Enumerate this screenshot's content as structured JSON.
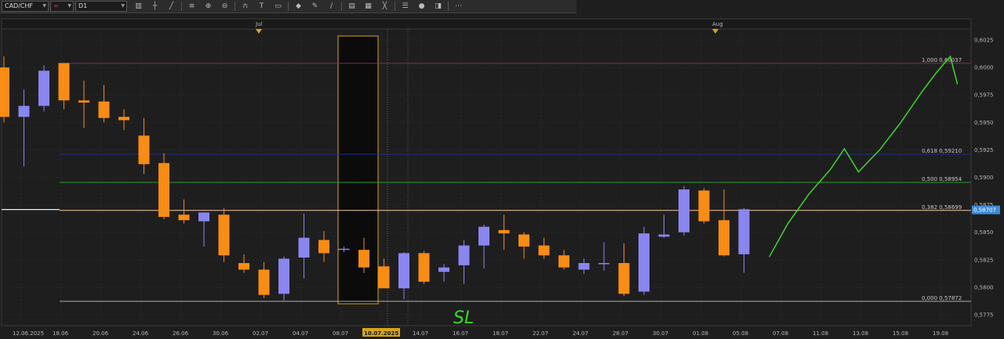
{
  "toolbar": {
    "symbol": "CAD/CHF",
    "timeframe": "D1",
    "icons": [
      "chart-type-icon",
      "crosshair-icon",
      "line-icon",
      "fib-icon",
      "zoom-in-icon",
      "zoom-out-icon",
      "magnet-icon",
      "text-icon",
      "note-icon",
      "shapes-icon",
      "brush-icon",
      "pen-icon",
      "objects-icon",
      "template-icon",
      "hide-icon",
      "layers-icon",
      "circle-icon",
      "eraser-icon",
      "more-icon"
    ]
  },
  "colors": {
    "background": "#1e1e1e",
    "grid": "#2a2a2a",
    "bull": "#8a86f0",
    "bear": "#f98c14",
    "fib_100": "#7a2e62",
    "fib_618": "#1c2e8a",
    "fib_500": "#2e9b2e",
    "fib_382": "#f7c79b",
    "fib_0": "#b0b0b0",
    "annotation": "#3fd62c",
    "price_tag": "#3c8cd8",
    "marker": "#d7a51a"
  },
  "chart_data": {
    "type": "candlestick",
    "symbol": "CAD/CHF",
    "timeframe": "D1",
    "ylim": [
      0.5765,
      0.6035
    ],
    "y_ticks": [
      "0,5775",
      "0,5800",
      "0,5825",
      "0,5850",
      "0,5875",
      "0,5900",
      "0,5925",
      "0,5950",
      "0,5975",
      "0,6000",
      "0,6025"
    ],
    "x_ticks": [
      "12.06.2025",
      "18.06",
      "20.06",
      "24.06",
      "26.06",
      "30.06",
      "02.07",
      "04.07",
      "08.07",
      "10.07.2025",
      "14.07",
      "16.07",
      "18.07",
      "22.07",
      "24.07",
      "28.07",
      "30.07",
      "01.08",
      "05.08",
      "07.08",
      "11.08",
      "13.08",
      "15.08",
      "19.08"
    ],
    "x_highlight": "10.07.2025",
    "month_markers": [
      "Jul",
      "Aug"
    ],
    "last_price": "0,58707",
    "candles": [
      {
        "o": 0.6,
        "h": 0.601,
        "l": 0.595,
        "c": 0.5955
      },
      {
        "o": 0.5955,
        "h": 0.598,
        "l": 0.591,
        "c": 0.5965
      },
      {
        "o": 0.5965,
        "h": 0.6002,
        "l": 0.596,
        "c": 0.5997
      },
      {
        "o": 0.6004,
        "h": 0.6004,
        "l": 0.5962,
        "c": 0.597
      },
      {
        "o": 0.597,
        "h": 0.5988,
        "l": 0.5945,
        "c": 0.5968
      },
      {
        "o": 0.5969,
        "h": 0.5984,
        "l": 0.595,
        "c": 0.5954
      },
      {
        "o": 0.5955,
        "h": 0.5962,
        "l": 0.5943,
        "c": 0.5952
      },
      {
        "o": 0.5938,
        "h": 0.5954,
        "l": 0.5903,
        "c": 0.5912
      },
      {
        "o": 0.5913,
        "h": 0.5922,
        "l": 0.5862,
        "c": 0.5864
      },
      {
        "o": 0.5866,
        "h": 0.588,
        "l": 0.5858,
        "c": 0.5861
      },
      {
        "o": 0.586,
        "h": 0.5868,
        "l": 0.5837,
        "c": 0.5868
      },
      {
        "o": 0.5866,
        "h": 0.5872,
        "l": 0.5823,
        "c": 0.5829
      },
      {
        "o": 0.5822,
        "h": 0.583,
        "l": 0.5813,
        "c": 0.5816
      },
      {
        "o": 0.5816,
        "h": 0.5823,
        "l": 0.579,
        "c": 0.5793
      },
      {
        "o": 0.5794,
        "h": 0.5828,
        "l": 0.5788,
        "c": 0.5826
      },
      {
        "o": 0.5827,
        "h": 0.5867,
        "l": 0.5808,
        "c": 0.5845
      },
      {
        "o": 0.5843,
        "h": 0.5851,
        "l": 0.5823,
        "c": 0.5831
      },
      {
        "o": 0.5834,
        "h": 0.5837,
        "l": 0.5832,
        "c": 0.5835
      },
      {
        "o": 0.5834,
        "h": 0.5845,
        "l": 0.5813,
        "c": 0.5818
      },
      {
        "o": 0.5819,
        "h": 0.5826,
        "l": 0.5806,
        "c": 0.5799
      },
      {
        "o": 0.5799,
        "h": 0.5832,
        "l": 0.5789,
        "c": 0.5831
      },
      {
        "o": 0.5831,
        "h": 0.5833,
        "l": 0.5803,
        "c": 0.5805
      },
      {
        "o": 0.5814,
        "h": 0.5821,
        "l": 0.5805,
        "c": 0.5818
      },
      {
        "o": 0.582,
        "h": 0.5843,
        "l": 0.5803,
        "c": 0.5838
      },
      {
        "o": 0.5838,
        "h": 0.5857,
        "l": 0.5817,
        "c": 0.5855
      },
      {
        "o": 0.5852,
        "h": 0.5866,
        "l": 0.5834,
        "c": 0.5849
      },
      {
        "o": 0.5848,
        "h": 0.585,
        "l": 0.5826,
        "c": 0.5837
      },
      {
        "o": 0.5838,
        "h": 0.5845,
        "l": 0.5826,
        "c": 0.5829
      },
      {
        "o": 0.5829,
        "h": 0.5834,
        "l": 0.5816,
        "c": 0.5818
      },
      {
        "o": 0.5816,
        "h": 0.5826,
        "l": 0.5812,
        "c": 0.5822
      },
      {
        "o": 0.5822,
        "h": 0.5841,
        "l": 0.5815,
        "c": 0.5822
      },
      {
        "o": 0.5822,
        "h": 0.584,
        "l": 0.5792,
        "c": 0.5794
      },
      {
        "o": 0.5796,
        "h": 0.5855,
        "l": 0.5793,
        "c": 0.5849
      },
      {
        "o": 0.5846,
        "h": 0.5866,
        "l": 0.5845,
        "c": 0.5848
      },
      {
        "o": 0.585,
        "h": 0.5892,
        "l": 0.5847,
        "c": 0.5889
      },
      {
        "o": 0.5888,
        "h": 0.589,
        "l": 0.5858,
        "c": 0.586
      },
      {
        "o": 0.5861,
        "h": 0.5889,
        "l": 0.5828,
        "c": 0.5829
      },
      {
        "o": 0.583,
        "h": 0.5872,
        "l": 0.5813,
        "c": 0.5871
      }
    ],
    "fib_levels": [
      {
        "ratio": "1,000",
        "price": 0.60037,
        "label": "1,000 0,60037"
      },
      {
        "ratio": "0,618",
        "price": 0.5921,
        "label": "0,618 0,59210"
      },
      {
        "ratio": "0,500",
        "price": 0.58954,
        "label": "0,500 0,58954"
      },
      {
        "ratio": "0,382",
        "price": 0.58699,
        "label": "0,382 0,58699"
      },
      {
        "ratio": "0,000",
        "price": 0.57872,
        "label": "0,000 0,57872"
      }
    ],
    "annotations": [
      {
        "type": "handwritten-text",
        "text": "SL",
        "near_date": "16.07",
        "near_price": 0.5778
      },
      {
        "type": "projected-path",
        "description": "hand-drawn bullish projection",
        "path": [
          {
            "day": 0.7,
            "p": 0.5828
          },
          {
            "day": 2,
            "p": 0.5858
          },
          {
            "day": 3.5,
            "p": 0.5885
          },
          {
            "day": 5,
            "p": 0.5907
          },
          {
            "day": 6,
            "p": 0.5926
          },
          {
            "day": 7,
            "p": 0.5905
          },
          {
            "day": 8.5,
            "p": 0.5925
          },
          {
            "day": 10,
            "p": 0.595
          },
          {
            "day": 11.5,
            "p": 0.5978
          },
          {
            "day": 12.5,
            "p": 0.5995
          },
          {
            "day": 13.5,
            "p": 0.601
          },
          {
            "day": 14,
            "p": 0.5985
          }
        ]
      }
    ]
  }
}
